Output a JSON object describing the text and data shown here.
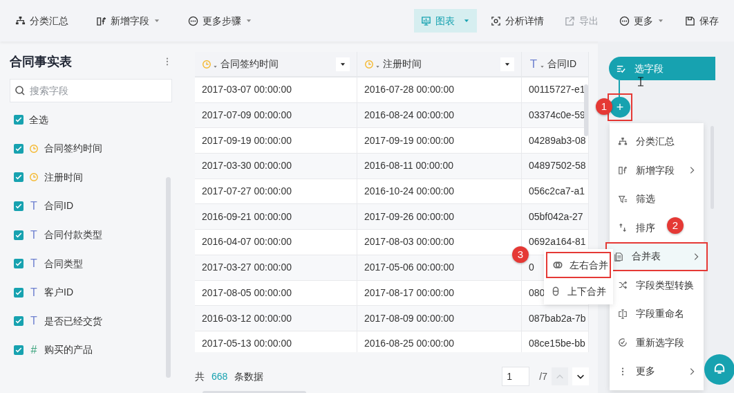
{
  "toolbar": [
    {
      "label": "分类汇总",
      "kind": "tree",
      "dropdown": false,
      "selected": false,
      "disabled": false
    },
    {
      "label": "新增字段",
      "kind": "addcol",
      "dropdown": true,
      "selected": false,
      "disabled": false
    },
    {
      "label": "更多步骤",
      "kind": "dots",
      "dropdown": true,
      "selected": false,
      "disabled": false
    },
    {
      "label": "图表",
      "kind": "chart",
      "dropdown": true,
      "selected": true,
      "disabled": false
    },
    {
      "label": "分析详情",
      "kind": "focus",
      "dropdown": false,
      "selected": false,
      "disabled": false
    },
    {
      "label": "导出",
      "kind": "export",
      "dropdown": false,
      "selected": false,
      "disabled": true
    },
    {
      "label": "更多",
      "kind": "dots",
      "dropdown": true,
      "selected": false,
      "disabled": false
    },
    {
      "label": "保存",
      "kind": "save",
      "dropdown": false,
      "selected": false,
      "disabled": false
    }
  ],
  "sidebar": {
    "title": "合同事实表",
    "search": {
      "placeholder": "搜索字段"
    },
    "select_all": {
      "label": "全选",
      "checked": true
    },
    "fields": [
      {
        "label": "合同签约时间",
        "kind": "time",
        "checked": true
      },
      {
        "label": "注册时间",
        "kind": "time",
        "checked": true
      },
      {
        "label": "合同ID",
        "kind": "text",
        "type_icon": "T",
        "checked": true
      },
      {
        "label": "合同付款类型",
        "kind": "text",
        "type_icon": "T",
        "checked": true
      },
      {
        "label": "合同类型",
        "kind": "text",
        "type_icon": "T",
        "checked": true
      },
      {
        "label": "客户ID",
        "kind": "text",
        "type_icon": "T",
        "checked": true
      },
      {
        "label": "是否已经交货",
        "kind": "text",
        "type_icon": "T",
        "checked": true
      },
      {
        "label": "购买的产品",
        "kind": "number",
        "type_icon": "#",
        "checked": true
      }
    ]
  },
  "table": {
    "columns": [
      {
        "label": "合同签约时间",
        "kind": "time",
        "dropdown": true
      },
      {
        "label": "注册时间",
        "kind": "time",
        "dropdown": true
      },
      {
        "label": "合同ID",
        "kind": "text",
        "type_icon": "T",
        "dropdown": false
      }
    ],
    "rows": [
      [
        "2017-03-07 00:00:00",
        "2016-07-28 00:00:00",
        "00115727-e1"
      ],
      [
        "2017-07-09 00:00:00",
        "2016-08-24 00:00:00",
        "03374c0e-59"
      ],
      [
        "2017-09-19 00:00:00",
        "2017-09-19 00:00:00",
        "04289ab3-08"
      ],
      [
        "2017-03-30 00:00:00",
        "2016-08-11 00:00:00",
        "04897502-58"
      ],
      [
        "2017-07-27 00:00:00",
        "2016-10-24 00:00:00",
        "056c2ca7-a1"
      ],
      [
        "2016-09-21 00:00:00",
        "2017-09-26 00:00:00",
        "05bf042a-27"
      ],
      [
        "2016-04-07 00:00:00",
        "2017-08-03 00:00:00",
        "0692a164-81"
      ],
      [
        "2017-03-27 00:00:00",
        "2017-05-06 00:00:00",
        "0"
      ],
      [
        "2017-08-05 00:00:00",
        "2017-08-17 00:00:00",
        "080"
      ],
      [
        "2016-03-12 00:00:00",
        "2017-08-09 00:00:00",
        "087bab2a-7b"
      ],
      [
        "2017-05-13 00:00:00",
        "2016-08-25 00:00:00",
        "08ce15be-bb"
      ]
    ],
    "footer": {
      "prefix": "共",
      "count": "668",
      "suffix": "条数据",
      "page": "1",
      "pages": "/7"
    }
  },
  "flow": {
    "node": {
      "label": "选字段"
    },
    "add_button": {
      "label": "+"
    },
    "menu": [
      {
        "label": "分类汇总",
        "kind": "tree",
        "submenu": false,
        "selected": false
      },
      {
        "label": "新增字段",
        "kind": "addcol",
        "submenu": true,
        "selected": false
      },
      {
        "label": "筛选",
        "kind": "filter",
        "submenu": false,
        "selected": false
      },
      {
        "label": "排序",
        "kind": "sort",
        "submenu": false,
        "selected": false
      },
      {
        "label": "合并表",
        "kind": "merge",
        "submenu": true,
        "selected": true
      },
      {
        "label": "字段类型转换",
        "kind": "shuffle",
        "submenu": false,
        "selected": false
      },
      {
        "label": "字段重命名",
        "kind": "rename",
        "submenu": false,
        "selected": false
      },
      {
        "label": "重新选字段",
        "kind": "check",
        "submenu": false,
        "selected": false
      },
      {
        "label": "更多",
        "kind": "vdots",
        "submenu": true,
        "selected": false
      }
    ],
    "submenu": [
      {
        "label": "左右合并",
        "kind": "lr",
        "selected": true
      },
      {
        "label": "上下合并",
        "kind": "ud",
        "selected": false
      }
    ],
    "badges": [
      "1",
      "2",
      "3"
    ]
  }
}
